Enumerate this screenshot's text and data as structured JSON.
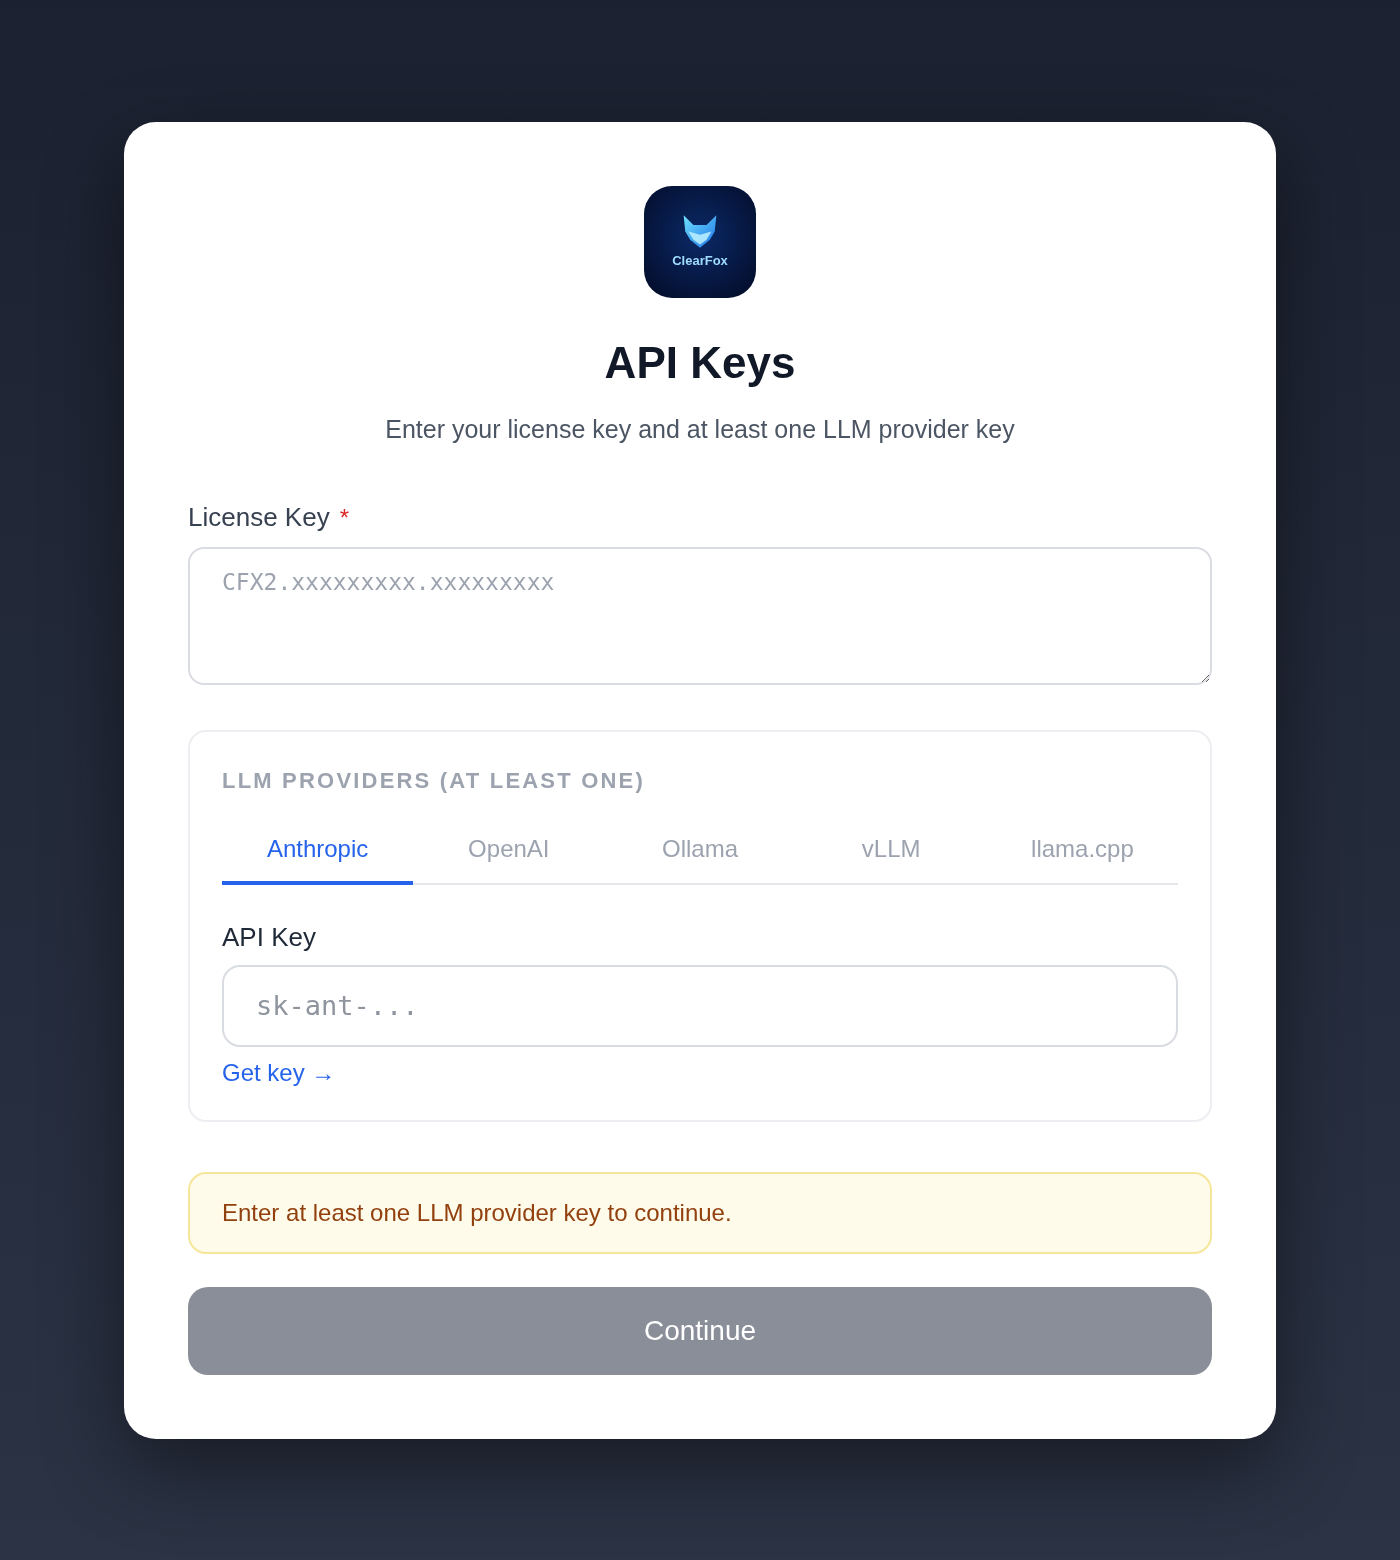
{
  "logo": {
    "text": "ClearFox"
  },
  "title": "API Keys",
  "subtitle": "Enter your license key and at least one LLM provider key",
  "license_key": {
    "label": "License Key",
    "required_mark": "*",
    "placeholder": "CFX2.xxxxxxxxx.xxxxxxxxx"
  },
  "providers": {
    "heading": "LLM PROVIDERS (AT LEAST ONE)",
    "tabs": [
      {
        "label": "Anthropic",
        "selected": true
      },
      {
        "label": "OpenAI",
        "selected": false
      },
      {
        "label": "Ollama",
        "selected": false
      },
      {
        "label": "vLLM",
        "selected": false
      },
      {
        "label": "llama.cpp",
        "selected": false
      }
    ],
    "field_label": "API Key",
    "placeholder": "sk-ant-...",
    "link": "Get key →"
  },
  "notice": {
    "text": "Enter at least one LLM provider key to continue."
  },
  "continue_button": {
    "label": "Continue",
    "disabled": true
  }
}
